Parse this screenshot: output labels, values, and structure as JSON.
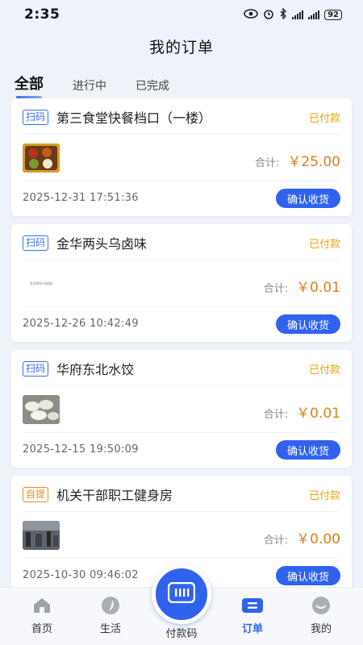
{
  "status_bar": {
    "time": "2:35",
    "battery": "92"
  },
  "title": "我的订单",
  "tabs": [
    {
      "label": "全部",
      "active": true
    },
    {
      "label": "进行中",
      "active": false
    },
    {
      "label": "已完成",
      "active": false
    }
  ],
  "orders": [
    {
      "tag": "扫码",
      "shop": "第三食堂快餐档口（一楼）",
      "status": "已付款",
      "total_label": "合计:",
      "total": "￥25.00",
      "time": "2025-12-31 17:51:36",
      "button": "确认收货",
      "thumb": "food"
    },
    {
      "tag": "扫码",
      "shop": "金华两头乌卤味",
      "status": "已付款",
      "total_label": "合计:",
      "total": "￥0.01",
      "time": "2025-12-26 10:42:49",
      "button": "确认收货",
      "thumb": "blank",
      "thumb_text": "金华两头乌卤味"
    },
    {
      "tag": "扫码",
      "shop": "华府东北水饺",
      "status": "已付款",
      "total_label": "合计:",
      "total": "￥0.01",
      "time": "2025-12-15 19:50:09",
      "button": "确认收货",
      "thumb": "dumplings"
    },
    {
      "tag": "自提",
      "shop": "机关干部职工健身房",
      "status": "已付款",
      "total_label": "合计:",
      "total": "￥0.00",
      "time": "2025-10-30 09:46:02",
      "button": "确认收货",
      "thumb": "gym"
    }
  ],
  "tabbar": [
    {
      "label": "首页",
      "icon": "home-icon"
    },
    {
      "label": "生活",
      "icon": "life-icon"
    },
    {
      "label": "付款码",
      "icon": "barcode-icon"
    },
    {
      "label": "订单",
      "icon": "order-icon",
      "active": true
    },
    {
      "label": "我的",
      "icon": "profile-icon"
    }
  ],
  "colors": {
    "accent": "#2f63ee",
    "paid": "#e9a70b",
    "price": "#e47d17",
    "pickup": "#f08c1a"
  }
}
